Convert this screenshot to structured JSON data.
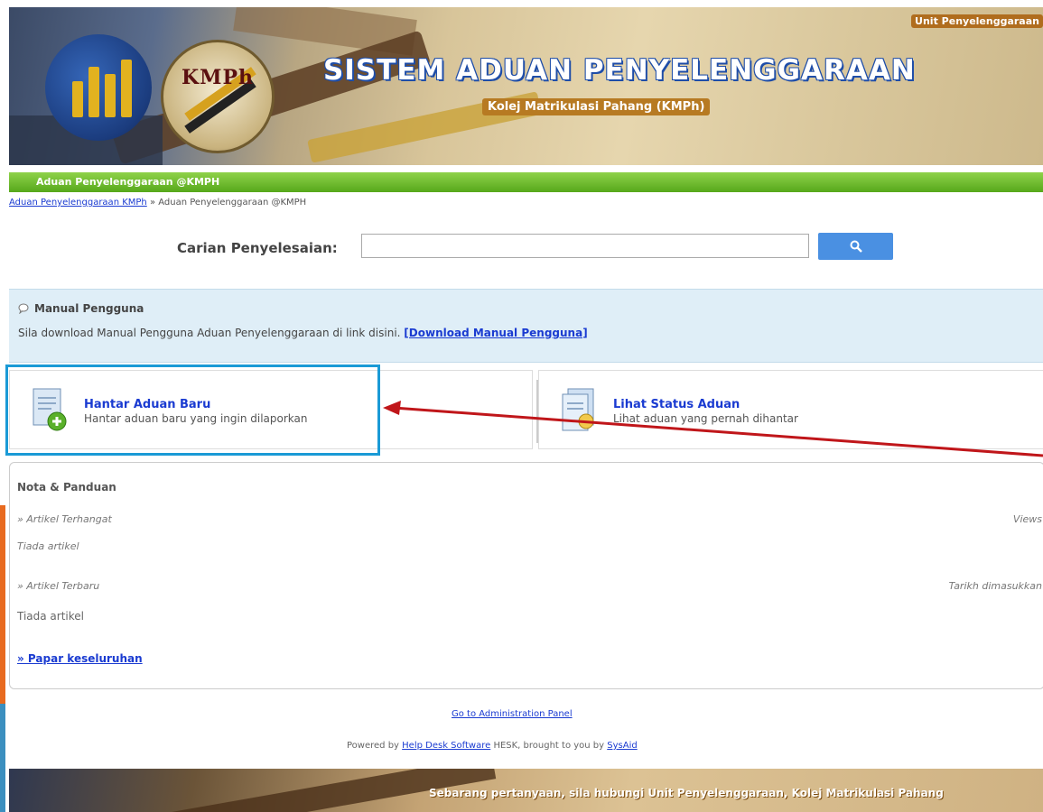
{
  "banner": {
    "unit_label": "Unit Penyelenggaraan",
    "title": "SISTEM ADUAN PENYELENGGARAAN",
    "subtitle": "Kolej Matrikulasi Pahang (KMPh)",
    "logo_text": "KMPh"
  },
  "navbar": {
    "title": "Aduan Penyelenggaraan @KMPH"
  },
  "breadcrumb": {
    "link": "Aduan Penyelenggaraan KMPh",
    "separator": "»",
    "current": "Aduan Penyelenggaraan @KMPH"
  },
  "search": {
    "label": "Carian Penyelesaian:",
    "value": "",
    "placeholder": ""
  },
  "manual": {
    "heading": "Manual Pengguna",
    "text": "Sila download Manual Pengguna Aduan Penyelenggaraan  di link disini.",
    "link": "[Download Manual Pengguna]"
  },
  "cards": [
    {
      "title": "Hantar Aduan Baru",
      "desc": "Hantar aduan baru yang ingin dilaporkan"
    },
    {
      "title": "Lihat Status Aduan",
      "desc": "Lihat aduan yang pernah dihantar"
    }
  ],
  "notes": {
    "heading": "Nota & Panduan",
    "section1": "» Artikel Terhangat",
    "section1_right": "Views",
    "section1_empty": "Tiada artikel",
    "section2": "» Artikel Terbaru",
    "section2_right": "Tarikh dimasukkan",
    "section2_empty": "Tiada artikel",
    "more": "» Papar keseluruhan"
  },
  "footer": {
    "admin_link": "Go to Administration Panel",
    "powered_prefix": "Powered by",
    "powered_link": "Help Desk Software",
    "powered_mid": "HESK, brought to you by",
    "powered_by_link": "SysAid"
  },
  "bottom_banner": {
    "message": "Sebarang pertanyaan, sila hubungi Unit Penyelenggaraan, Kolej Matrikulasi Pahang"
  },
  "colors": {
    "accent_blue": "#1a9ad6",
    "nav_green": "#6bbd2c",
    "link": "#1a3bd1",
    "arrow": "#c0161a"
  }
}
